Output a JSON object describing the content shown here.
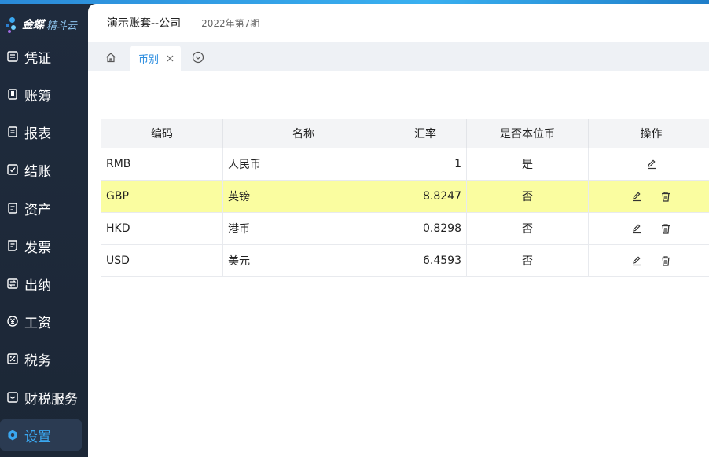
{
  "brand": {
    "name": "金蝶",
    "sub": "精斗云"
  },
  "sidebar": {
    "items": [
      {
        "label": "凭证",
        "icon": "voucher-icon"
      },
      {
        "label": "账簿",
        "icon": "ledger-icon"
      },
      {
        "label": "报表",
        "icon": "report-icon"
      },
      {
        "label": "结账",
        "icon": "close-account-icon"
      },
      {
        "label": "资产",
        "icon": "asset-icon"
      },
      {
        "label": "发票",
        "icon": "invoice-icon"
      },
      {
        "label": "出纳",
        "icon": "cashier-icon"
      },
      {
        "label": "工资",
        "icon": "salary-icon"
      },
      {
        "label": "税务",
        "icon": "tax-icon"
      },
      {
        "label": "财税服务",
        "icon": "service-icon"
      },
      {
        "label": "设置",
        "icon": "settings-icon",
        "active": true
      }
    ]
  },
  "header": {
    "account": "演示账套--公司",
    "period": "2022年第7期"
  },
  "tabs": {
    "active_label": "币别"
  },
  "table": {
    "columns": [
      "编码",
      "名称",
      "汇率",
      "是否本位币",
      "操作"
    ],
    "rows": [
      {
        "code": "RMB",
        "name": "人民币",
        "rate": "1",
        "base": "是",
        "deletable": false,
        "highlight": false
      },
      {
        "code": "GBP",
        "name": "英镑",
        "rate": "8.8247",
        "base": "否",
        "deletable": true,
        "highlight": true
      },
      {
        "code": "HKD",
        "name": "港币",
        "rate": "0.8298",
        "base": "否",
        "deletable": true,
        "highlight": false
      },
      {
        "code": "USD",
        "name": "美元",
        "rate": "6.4593",
        "base": "否",
        "deletable": true,
        "highlight": false
      }
    ]
  },
  "colors": {
    "accent": "#2f8fe0",
    "sidebar_bg": "#1f2b3d",
    "highlight_row": "#fafda0"
  }
}
